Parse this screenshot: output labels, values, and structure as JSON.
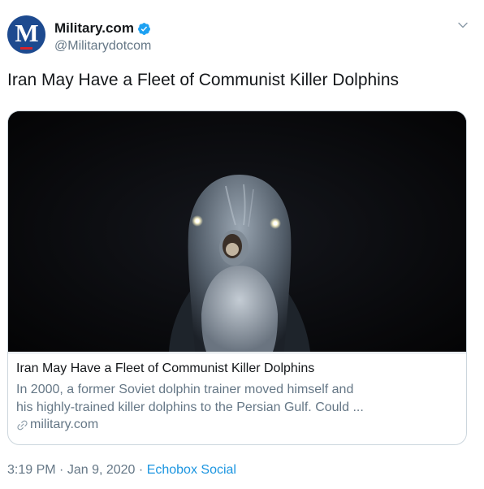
{
  "author": {
    "avatar_letter": "M",
    "display_name": "Military.com",
    "handle": "@Militarydotcom",
    "verified": true
  },
  "tweet": {
    "text": "Iran May Have a Fleet of Communist Killer Dolphins"
  },
  "card": {
    "image_subject": "dolphin-photo",
    "title": "Iran May Have a Fleet of Communist Killer Dolphins",
    "description_line1": "In 2000, a former Soviet dolphin trainer moved himself and",
    "description_line2": "his highly-trained killer dolphins to the Persian Gulf. Could ...",
    "domain": "military.com"
  },
  "meta": {
    "time": "3:19 PM",
    "sep1": "·",
    "date": "Jan 9, 2020",
    "sep2": "·",
    "source": "Echobox Social"
  },
  "icons": {
    "verified": "verified-badge-icon",
    "caret": "chevron-down-icon",
    "link": "link-icon"
  },
  "colors": {
    "verified_blue": "#1da1f2",
    "link_blue": "#1b95e0",
    "secondary_text": "#657786",
    "avatar_blue": "#1d4a8f",
    "avatar_red": "#d9232a"
  }
}
